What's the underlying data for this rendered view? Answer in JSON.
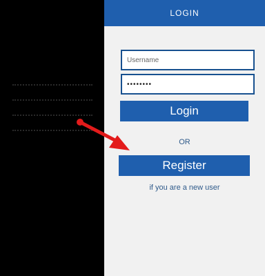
{
  "login_panel": {
    "header": "LOGIN",
    "username": {
      "placeholder": "Username",
      "value": ""
    },
    "password": {
      "value": "••••••••"
    },
    "login_button": "Login",
    "separator": "OR",
    "register_button": "Register",
    "register_hint": "if you are a new user"
  },
  "annotation": {
    "arrow_color": "#e31b1b",
    "note_lines": 4
  },
  "colors": {
    "accent": "#1f5fae",
    "field_border": "#17508f",
    "panel_bg": "#f1f1f1",
    "left_bg": "#000000"
  }
}
